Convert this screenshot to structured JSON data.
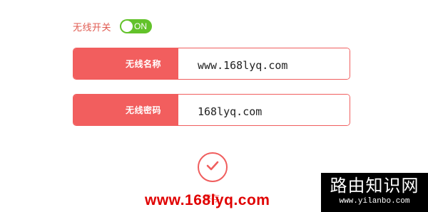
{
  "wireless": {
    "toggle_label": "无线开关",
    "toggle_state": "ON",
    "toggle_color": "#62c22a"
  },
  "form": {
    "ssid_label": "无线名称",
    "ssid_value": "www.168lyq.com",
    "password_label": "无线密码",
    "password_value": "168lyq.com",
    "accent_color": "#f25e5e"
  },
  "actions": {
    "save_label": "保存",
    "save_icon": "checkmark-icon"
  },
  "watermark": {
    "url": "www.168lyq.com",
    "color": "#e00000"
  },
  "logo": {
    "title": "路由知识网",
    "url": "www.yilanbo.com"
  }
}
